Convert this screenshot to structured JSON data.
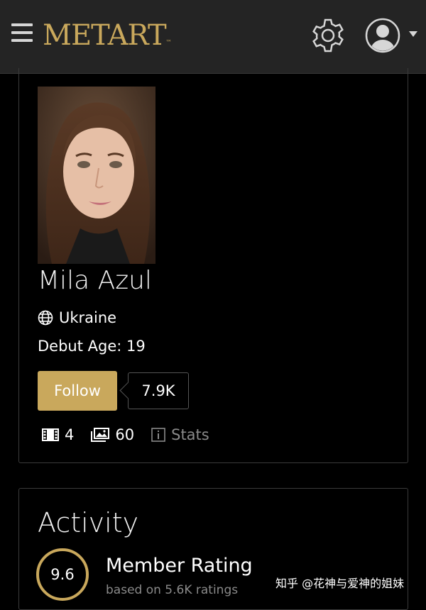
{
  "header": {
    "logo": "METART",
    "logo_mark": "™",
    "menu_icon": "hamburger-icon",
    "settings_icon": "gear-icon",
    "account_icon": "user-avatar-icon",
    "dropdown_icon": "caret-down-icon"
  },
  "profile": {
    "name": "Mila Azul",
    "country": "Ukraine",
    "debut_age": "Debut Age: 19",
    "follow_label": "Follow",
    "followers": "7.9K",
    "stats": {
      "videos": "4",
      "galleries": "60",
      "stats_label": "Stats"
    }
  },
  "activity": {
    "title": "Activity",
    "rating": "9.6",
    "rating_label": "Member Rating",
    "rating_sub": "based on 5.6K ratings"
  },
  "watermark": "知乎 @花神与爱神的姐妹",
  "colors": {
    "accent": "#c9a85c",
    "topbar": "#242424",
    "background": "#000000"
  }
}
